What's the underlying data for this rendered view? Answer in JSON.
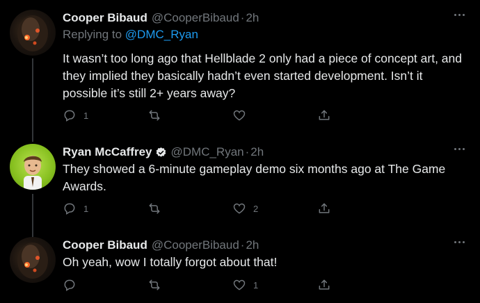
{
  "tweets": [
    {
      "name": "Cooper Bibaud",
      "handle": "@CooperBibaud",
      "time": "2h",
      "replying_prefix": "Replying to",
      "replying_handle": "@DMC_Ryan",
      "text": "It wasn’t too long ago that Hellblade 2 only had a piece of concept art, and they implied they basically hadn’t even started development. Isn’t it possible it’s still 2+ years away?",
      "replies": "1",
      "retweets": "",
      "likes": ""
    },
    {
      "name": "Ryan McCaffrey",
      "handle": "@DMC_Ryan",
      "time": "2h",
      "verified": true,
      "text": "They showed a 6-minute gameplay demo six months ago at The Game Awards.",
      "replies": "1",
      "retweets": "",
      "likes": "2"
    },
    {
      "name": "Cooper Bibaud",
      "handle": "@CooperBibaud",
      "time": "2h",
      "text": "Oh yeah, wow I totally forgot about that!",
      "replies": "",
      "retweets": "",
      "likes": "1"
    }
  ],
  "separator": "·",
  "icons": {
    "reply": "reply-icon",
    "retweet": "retweet-icon",
    "like": "heart-icon",
    "share": "share-icon",
    "more": "more-icon",
    "verified": "verified-badge-icon"
  },
  "colors": {
    "background": "#000000",
    "text": "#e7e9ea",
    "muted": "#71767b",
    "link": "#1d9bf0"
  }
}
